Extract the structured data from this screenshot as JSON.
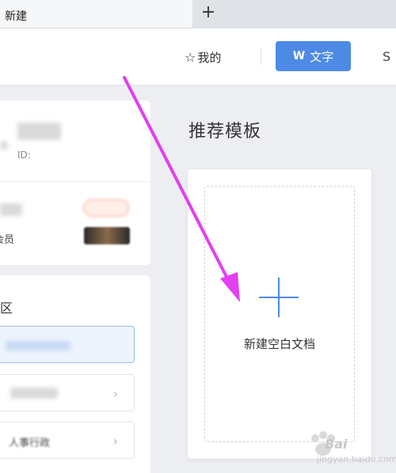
{
  "tabbar": {
    "tab_title": "新建",
    "new_tab": "+"
  },
  "header": {
    "mine_label": "我的",
    "doc_tab_icon": "W",
    "doc_tab_label": "文字",
    "next_tab_label": "S"
  },
  "user_card": {
    "id_label": "ID:",
    "member_label": "会员"
  },
  "section_card": {
    "title": "区",
    "rows": [
      {
        "label": "",
        "active": true
      },
      {
        "label": "",
        "active": false
      },
      {
        "label": "人事行政",
        "active": false
      }
    ]
  },
  "main": {
    "section_title": "推荐模板",
    "blank_doc_label": "新建空白文档"
  },
  "watermark": {
    "brand": "Bai",
    "sub": "jingyan.baidu.com"
  },
  "colors": {
    "accent": "#4d8ae5",
    "annotation_arrow": "#e23ff0"
  }
}
